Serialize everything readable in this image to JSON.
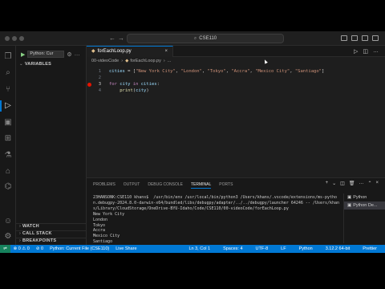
{
  "titlebar": {
    "search_text": "CSE110",
    "back": "←",
    "forward": "→"
  },
  "activity_bar": {
    "icons": [
      "files-icon",
      "search-icon",
      "source-control-icon",
      "run-debug-icon",
      "remote-explorer-icon",
      "extensions-icon",
      "testing-icon",
      "flask-icon",
      "debug-console-icon",
      "accounts-icon",
      "settings-icon"
    ]
  },
  "sidebar": {
    "run_label": "Python: Cur",
    "variables": "VARIABLES",
    "watch": "WATCH",
    "call_stack": "CALL STACK",
    "breakpoints": "BREAKPOINTS"
  },
  "editor": {
    "tab_label": "forEachLoop.py",
    "breadcrumb": [
      "00-videoCode",
      "forEachLoop.py",
      "..."
    ],
    "lines": [
      {
        "num": "1",
        "tokens": [
          [
            "var",
            "cities"
          ],
          [
            "op",
            " = ["
          ],
          [
            "str",
            "\"New York City\""
          ],
          [
            "op",
            ", "
          ],
          [
            "str",
            "\"London\""
          ],
          [
            "op",
            ", "
          ],
          [
            "str",
            "\"Tokyo\""
          ],
          [
            "op",
            ", "
          ],
          [
            "str",
            "\"Accra\""
          ],
          [
            "op",
            ", "
          ],
          [
            "str",
            "\"Mexico City\""
          ],
          [
            "op",
            ", "
          ],
          [
            "str",
            "\"Santiago\""
          ],
          [
            "op",
            "]"
          ]
        ]
      },
      {
        "num": "2",
        "tokens": []
      },
      {
        "num": "3",
        "breakpoint": true,
        "tokens": [
          [
            "kw",
            "for "
          ],
          [
            "var",
            "city"
          ],
          [
            "kw",
            " in "
          ],
          [
            "var",
            "cities"
          ],
          [
            "op",
            ":"
          ]
        ]
      },
      {
        "num": "4",
        "tokens": [
          [
            "op",
            "    "
          ],
          [
            "fn",
            "print"
          ],
          [
            "op",
            "("
          ],
          [
            "var",
            "city"
          ],
          [
            "op",
            ")"
          ]
        ]
      }
    ]
  },
  "panel": {
    "tabs": [
      "PROBLEMS",
      "OUTPUT",
      "DEBUG CONSOLE",
      "TERMINAL",
      "PORTS"
    ],
    "active_tab": "TERMINAL",
    "terminal_lines": [
      "23HANSONK:CSE110 khans$  /usr/bin/env /usr/local/bin/python3 /Users/khans/.vscode/extensions/ms-python.debugpy-2024.8.0-darwin-x64/bundled/libs/debugpy/adapter/../../debugpy/launcher 64246 -- /Users/khans/Library/CloudStorage/OneDrive-BYU-Idaho/Code/CSE110/00-videoCode/forEachLoop.py",
      "New York City",
      "London",
      "Tokyo",
      "Accra",
      "Mexico City",
      "Santiago",
      "▯"
    ],
    "terminal_list": [
      "Python",
      "Python De..."
    ]
  },
  "statusbar": {
    "left": [
      "⊗ 0 ⚠ 0",
      "⊘ 0",
      "Python: Current File (CSE110)",
      "Live Share"
    ],
    "right": [
      "Ln 3, Col 1",
      "Spaces: 4",
      "UTF-8",
      "LF",
      "Python",
      "3.12.2 64-bit",
      "Prettier"
    ]
  }
}
